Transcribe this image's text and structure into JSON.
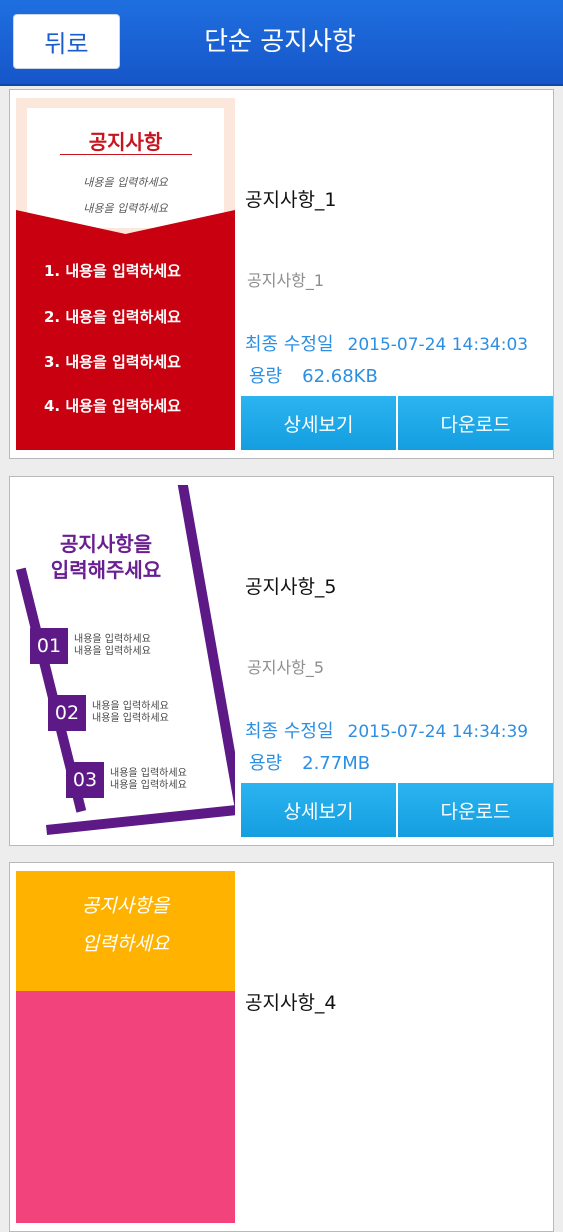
{
  "header": {
    "back_label": "뒤로",
    "title": "단순 공지사항"
  },
  "labels": {
    "modified": "최종 수정일",
    "size": "용량",
    "detail": "상세보기",
    "download": "다운로드"
  },
  "items": [
    {
      "name": "공지사항_1",
      "desc": "공지사항_1",
      "modified": "2015-07-24 14:34:03",
      "size": "62.68KB",
      "thumb": {
        "title": "공지사항",
        "subs": [
          "내용을 입력하세요",
          "내용을 입력하세요"
        ],
        "list": [
          "1. 내용을 입력하세요",
          "2. 내용을 입력하세요",
          "3. 내용을 입력하세요",
          "4. 내용을 입력하세요"
        ]
      }
    },
    {
      "name": "공지사항_5",
      "desc": "공지사항_5",
      "modified": "2015-07-24 14:34:39",
      "size": "2.77MB",
      "thumb": {
        "title_line1": "공지사항을",
        "title_line2": "입력해주세요",
        "steps": [
          {
            "num": "01",
            "line1": "내용을 입력하세요",
            "line2": "내용을 입력하세요"
          },
          {
            "num": "02",
            "line1": "내용을 입력하세요",
            "line2": "내용을 입력하세요"
          },
          {
            "num": "03",
            "line1": "내용을 입력하세요",
            "line2": "내용을 입력하세요"
          }
        ]
      }
    },
    {
      "name": "공지사항_4",
      "thumb": {
        "title_line1": "공지사항을",
        "title_line2": "입력하세요"
      }
    }
  ]
}
